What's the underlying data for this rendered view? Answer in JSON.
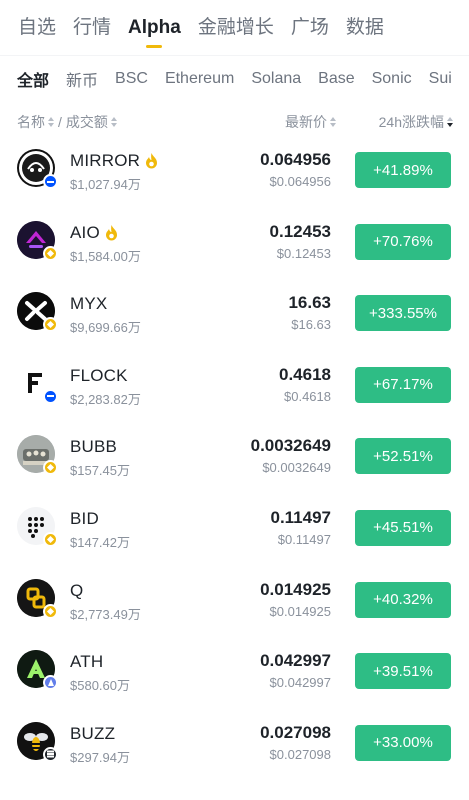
{
  "top_tabs": [
    "自选",
    "行情",
    "Alpha",
    "金融增长",
    "广场",
    "数据"
  ],
  "chain_tabs": [
    "全部",
    "新币",
    "BSC",
    "Ethereum",
    "Solana",
    "Base",
    "Sonic",
    "Sui"
  ],
  "columns": {
    "name": "名称",
    "separator": "/",
    "volume": "成交额",
    "price": "最新价",
    "change": "24h涨跌幅"
  },
  "colors": {
    "accent": "#f0b90b",
    "positive": "#2ebd85"
  },
  "rows": [
    {
      "symbol": "MIRROR",
      "hot": true,
      "chain": "base",
      "volume": "$1,027.94万",
      "price": "0.064956",
      "price_usd": "$0.064956",
      "change": "+41.89%"
    },
    {
      "symbol": "AIO",
      "hot": true,
      "chain": "bsc",
      "volume": "$1,584.00万",
      "price": "0.12453",
      "price_usd": "$0.12453",
      "change": "+70.76%"
    },
    {
      "symbol": "MYX",
      "hot": false,
      "chain": "bsc",
      "volume": "$9,699.66万",
      "price": "16.63",
      "price_usd": "$16.63",
      "change": "+333.55%"
    },
    {
      "symbol": "FLOCK",
      "hot": false,
      "chain": "base",
      "volume": "$2,283.82万",
      "price": "0.4618",
      "price_usd": "$0.4618",
      "change": "+67.17%"
    },
    {
      "symbol": "BUBB",
      "hot": false,
      "chain": "bsc",
      "volume": "$157.45万",
      "price": "0.0032649",
      "price_usd": "$0.0032649",
      "change": "+52.51%"
    },
    {
      "symbol": "BID",
      "hot": false,
      "chain": "bsc",
      "volume": "$147.42万",
      "price": "0.11497",
      "price_usd": "$0.11497",
      "change": "+45.51%"
    },
    {
      "symbol": "Q",
      "hot": false,
      "chain": "bsc",
      "volume": "$2,773.49万",
      "price": "0.014925",
      "price_usd": "$0.014925",
      "change": "+40.32%"
    },
    {
      "symbol": "ATH",
      "hot": false,
      "chain": "eth",
      "volume": "$580.60万",
      "price": "0.042997",
      "price_usd": "$0.042997",
      "change": "+39.51%"
    },
    {
      "symbol": "BUZZ",
      "hot": false,
      "chain": "sol",
      "volume": "$297.94万",
      "price": "0.027098",
      "price_usd": "$0.027098",
      "change": "+33.00%"
    }
  ]
}
